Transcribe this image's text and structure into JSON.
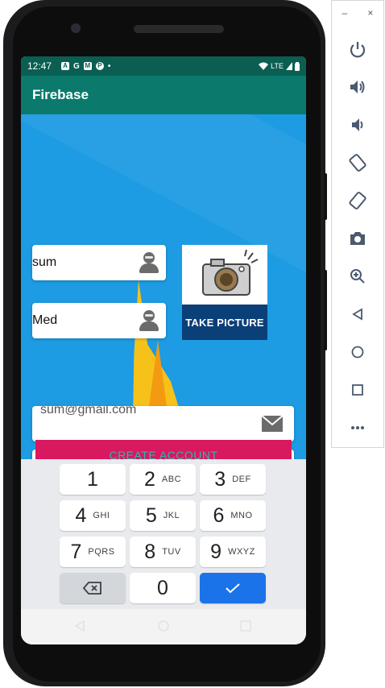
{
  "status_bar": {
    "time": "12:47",
    "icons": [
      "A",
      "G",
      "M",
      "P",
      "•"
    ],
    "network": "LTE"
  },
  "app_bar": {
    "title": "Firebase"
  },
  "form": {
    "first_name_value": "sum",
    "last_name_value": "Med",
    "email_value": "sum@gmail.com",
    "password_value": "••••••",
    "take_picture_label": "TAKE PICTURE",
    "create_account_label": "CREATE ACCOUNT"
  },
  "keyboard": {
    "keys": [
      {
        "num": "1",
        "letters": ""
      },
      {
        "num": "2",
        "letters": "ABC"
      },
      {
        "num": "3",
        "letters": "DEF"
      },
      {
        "num": "4",
        "letters": "GHI"
      },
      {
        "num": "5",
        "letters": "JKL"
      },
      {
        "num": "6",
        "letters": "MNO"
      },
      {
        "num": "7",
        "letters": "PQRS"
      },
      {
        "num": "8",
        "letters": "TUV"
      },
      {
        "num": "9",
        "letters": "WXYZ"
      },
      {
        "num": "0",
        "letters": ""
      }
    ]
  },
  "emulator_toolbar": {
    "minimize_label": "–",
    "close_label": "×",
    "buttons": [
      "power-icon",
      "volume-up-icon",
      "volume-down-icon",
      "rotate-left-icon",
      "rotate-right-icon",
      "camera-icon",
      "zoom-icon",
      "back-icon",
      "home-icon",
      "overview-icon",
      "more-icon"
    ]
  },
  "colors": {
    "status_bar": "#0a5e52",
    "app_bar": "#0b7a6c",
    "background": "#1d9be3",
    "take_picture_bg": "#0b3f78",
    "create_account_bg": "#d9195f",
    "enter_key": "#1a73e8"
  }
}
